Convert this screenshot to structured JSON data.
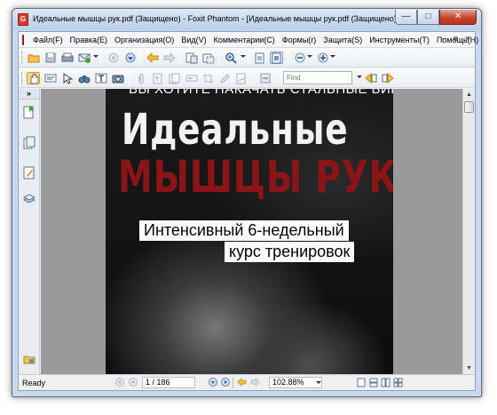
{
  "window": {
    "title": "Идеальные мышцы рук.pdf (Защищено) - Foxit Phantom - [Идеальные мышцы рук.pdf (Защищено)]",
    "controls": {
      "minimize": "—",
      "maximize": "□",
      "close": "✕"
    }
  },
  "menu": {
    "items": [
      {
        "label": "Файл(F)"
      },
      {
        "label": "Правка(E)"
      },
      {
        "label": "Организация(O)"
      },
      {
        "label": "Вид(V)"
      },
      {
        "label": "Комментарии(C)"
      },
      {
        "label": "Формы(r)"
      },
      {
        "label": "Защита(S)"
      },
      {
        "label": "Инструменты(T)"
      },
      {
        "label": "Помощь(H)"
      }
    ],
    "mdi": {
      "minimize": "‒",
      "restore": "⧉",
      "close": "✕"
    }
  },
  "toolbar": {
    "find_placeholder": "Find"
  },
  "navpanel": {
    "collapse_label": "»"
  },
  "document": {
    "top_text": "ВЫ ХОТИТЕ НАКАЧАТЬ СТАЛЬНЫЕ БИЦЕПСЫ?",
    "title_line1": "Идеальные",
    "title_line2": "МЫШЦЫ РУК",
    "subtitle_line1": "Интенсивный 6-недельный",
    "subtitle_line2": "курс тренировок"
  },
  "status": {
    "ready": "Ready",
    "page_display": "1 / 186",
    "zoom": "102.88%"
  },
  "colors": {
    "accent_red": "#8b1418",
    "title_blue": "#c9daee",
    "close_red": "#c5432f"
  }
}
